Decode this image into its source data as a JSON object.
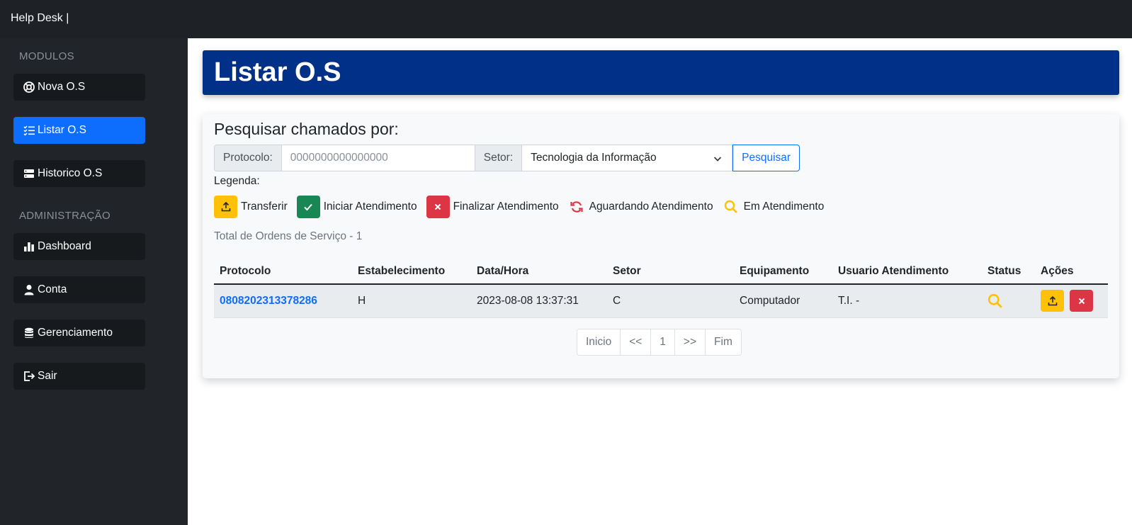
{
  "app": {
    "brand": "Help Desk |"
  },
  "sidebar": {
    "heading_modules": "MODULOS",
    "heading_admin": "ADMINISTRAÇÃO",
    "items": [
      {
        "label": "Nova O.S",
        "icon": "life-ring-icon"
      },
      {
        "label": "Listar O.S",
        "icon": "list-check-icon"
      },
      {
        "label": "Historico O.S",
        "icon": "server-icon"
      },
      {
        "label": "Dashboard",
        "icon": "bar-chart-icon"
      },
      {
        "label": "Conta",
        "icon": "person-icon"
      },
      {
        "label": "Gerenciamento",
        "icon": "database-icon"
      },
      {
        "label": "Sair",
        "icon": "logout-icon"
      }
    ],
    "active_index": 1
  },
  "page": {
    "title": "Listar O.S"
  },
  "search": {
    "heading": "Pesquisar chamados por:",
    "protocol_label": "Protocolo:",
    "protocol_placeholder": "0000000000000000",
    "sector_label": "Setor:",
    "sector_selected": "Tecnologia da Informação",
    "button_label": "Pesquisar"
  },
  "legend": {
    "title": "Legenda:",
    "items": [
      {
        "label": "Transferir",
        "icon": "upload-icon",
        "color": "#ffc107"
      },
      {
        "label": "Iniciar Atendimento",
        "icon": "check-icon",
        "color": "#198754"
      },
      {
        "label": "Finalizar Atendimento",
        "icon": "x-icon",
        "color": "#dc3545"
      },
      {
        "label": "Aguardando Atendimento",
        "icon": "refresh-icon",
        "color": "#dc3545"
      },
      {
        "label": "Em Atendimento",
        "icon": "search-icon",
        "color": "#ffc107"
      }
    ]
  },
  "total_text": "Total de Ordens de Serviço - 1",
  "table": {
    "headers": [
      "Protocolo",
      "Estabelecimento",
      "Data/Hora",
      "Setor",
      "Equipamento",
      "Usuario Atendimento",
      "Status",
      "Ações"
    ],
    "rows": [
      {
        "protocolo": "0808202313378286",
        "estabelecimento": "H",
        "data_hora": "2023-08-08 13:37:31",
        "setor": "C",
        "equipamento": "Computador",
        "usuario": "T.I. -",
        "status_icon": "search-icon"
      }
    ]
  },
  "pagination": [
    "Inicio",
    "<<",
    "1",
    ">>",
    "Fim"
  ],
  "colors": {
    "primary": "#0d6efd",
    "title_bg": "#003087",
    "warning": "#ffc107",
    "danger": "#dc3545",
    "success": "#198754"
  }
}
